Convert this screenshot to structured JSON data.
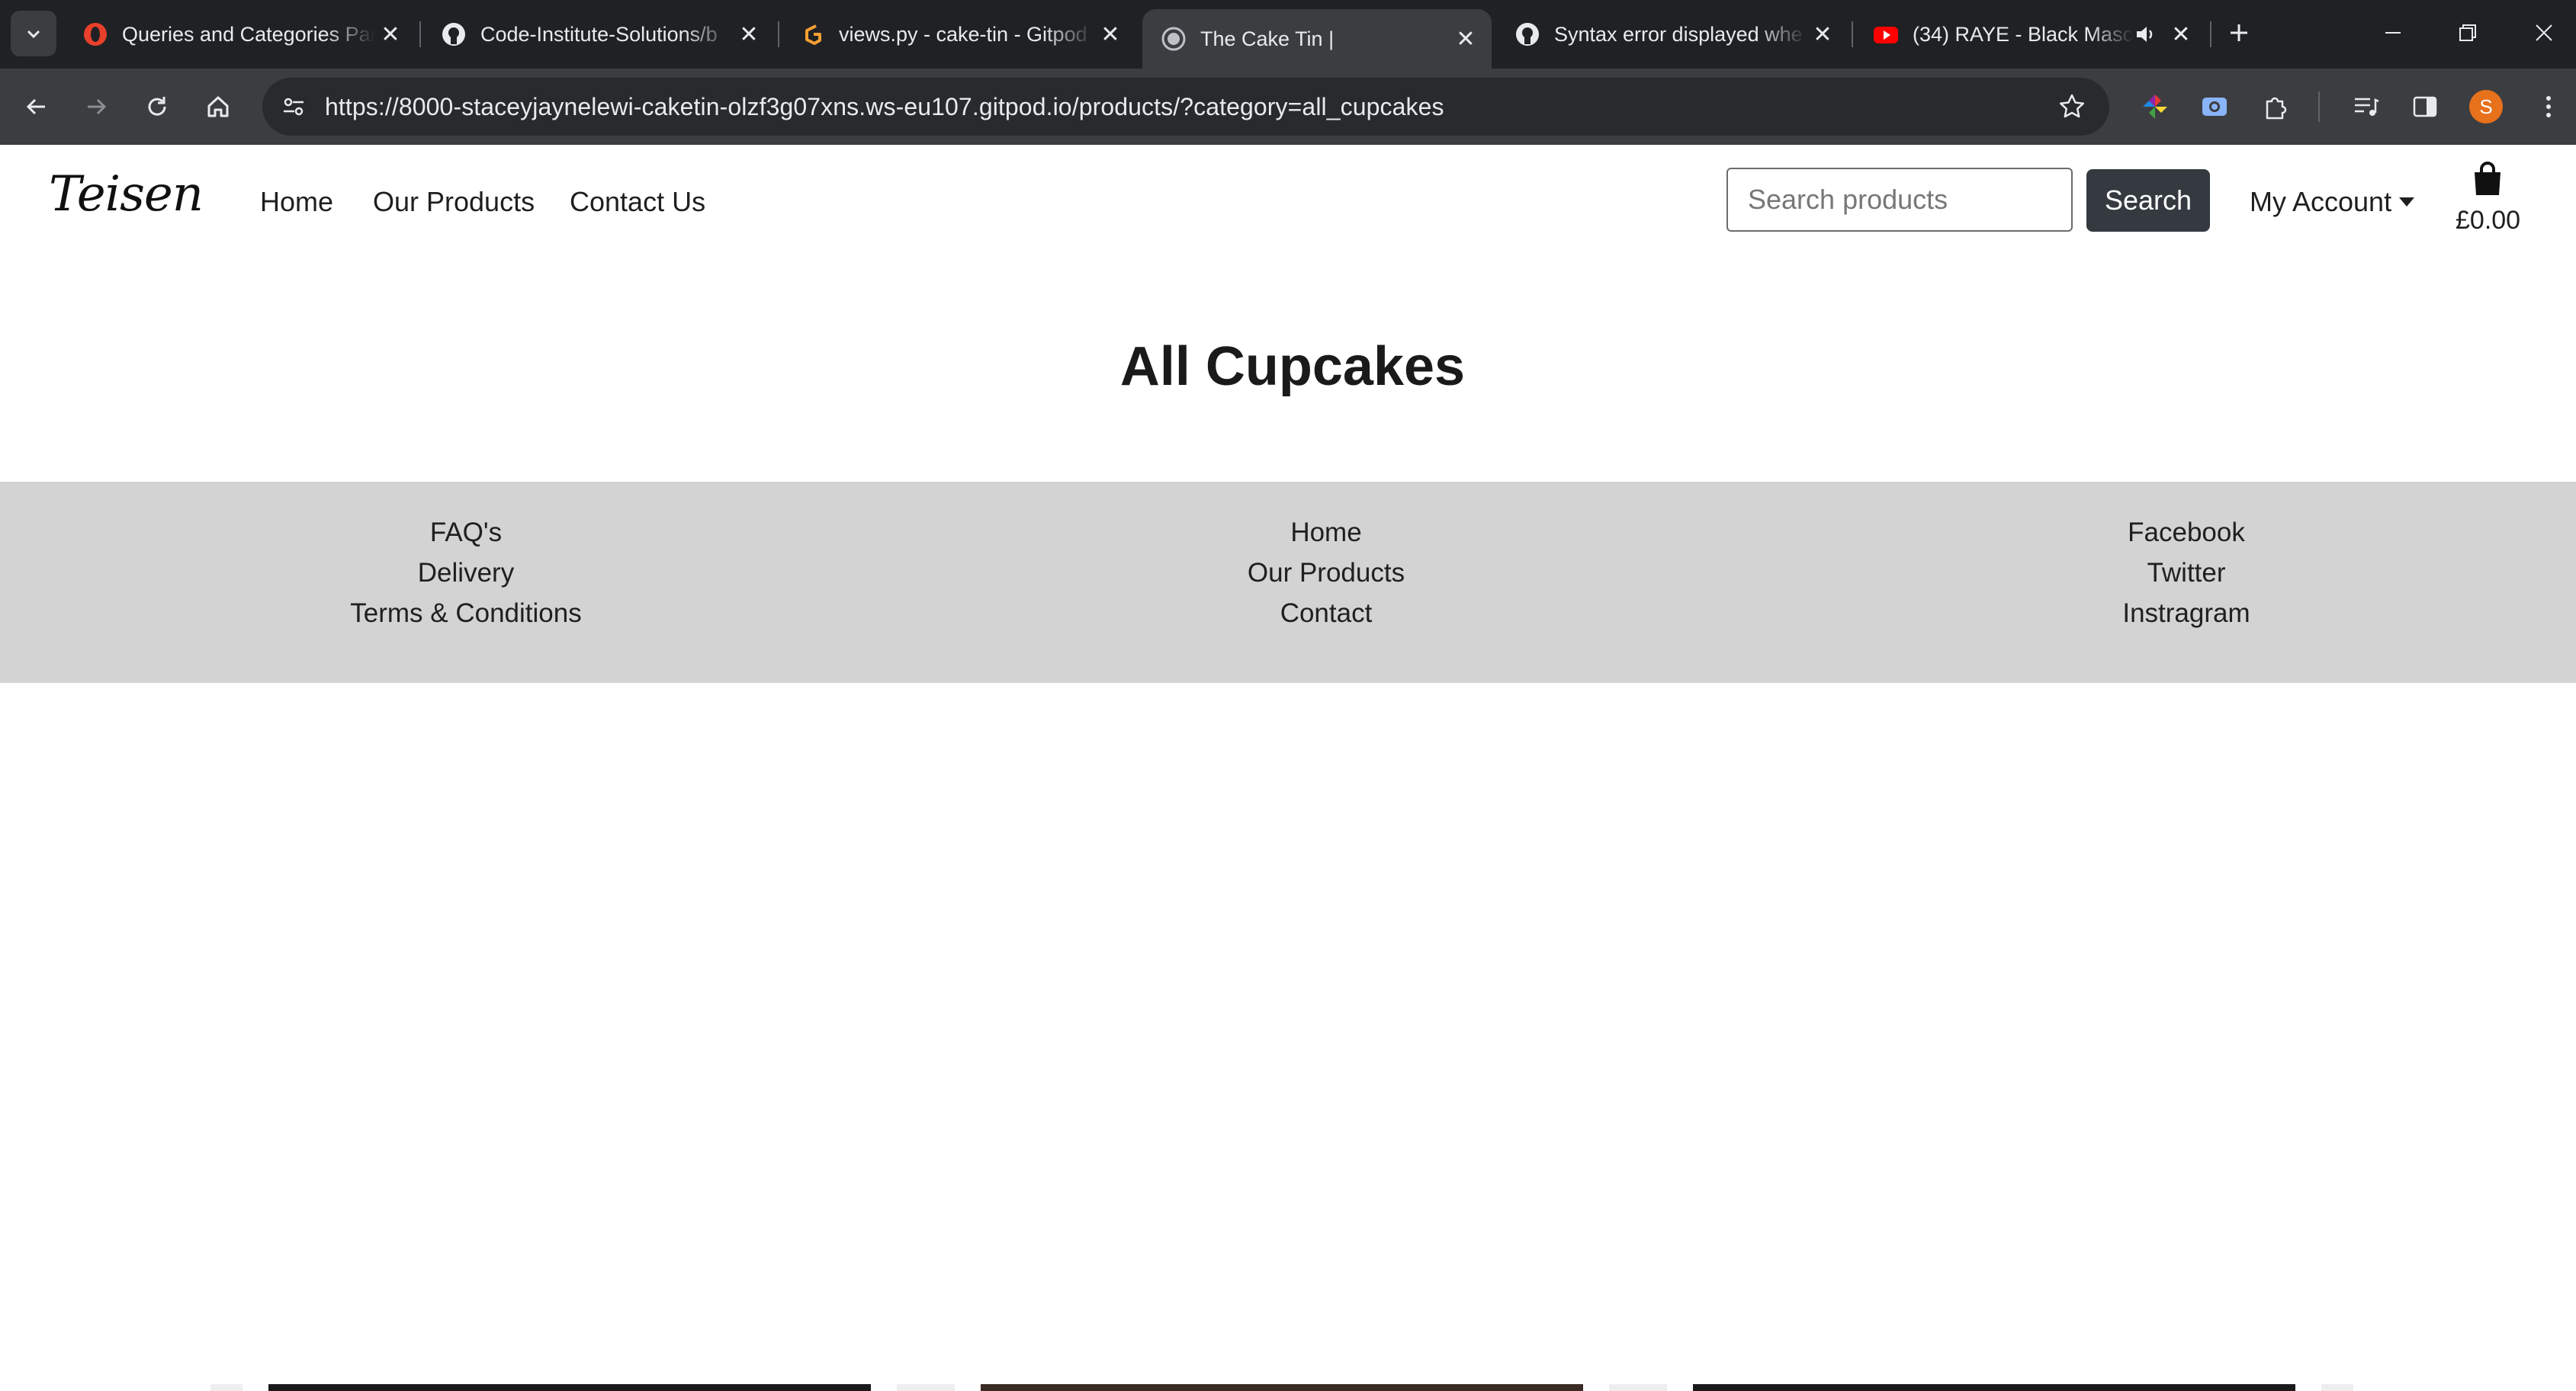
{
  "browser": {
    "tabs": [
      {
        "title": "Queries and Categories Par",
        "icon": "opera-red-icon",
        "active": false
      },
      {
        "title": "Code-Institute-Solutions/b",
        "icon": "github-icon",
        "active": false
      },
      {
        "title": "views.py - cake-tin - Gitpod",
        "icon": "gitpod-icon",
        "active": false
      },
      {
        "title": "The Cake Tin |",
        "icon": "globe-icon",
        "active": true
      },
      {
        "title": "Syntax error displayed whe",
        "icon": "github-icon",
        "active": false
      },
      {
        "title": "(34) RAYE - Black Masc",
        "icon": "youtube-icon",
        "active": false
      }
    ],
    "url": "https://8000-staceyjaynelewi-caketin-olzf3g07xns.ws-eu107.gitpod.io/products/?category=all_cupcakes",
    "profile_initial": "S"
  },
  "header": {
    "logo": "Teisen",
    "nav": {
      "home": "Home",
      "products": "Our Products",
      "contact": "Contact Us"
    },
    "search": {
      "placeholder": "Search products",
      "button": "Search"
    },
    "account": "My Account",
    "cart_total": "£0.00"
  },
  "main": {
    "title": "All Cupcakes"
  },
  "footer": {
    "col1": [
      "FAQ's",
      "Delivery",
      "Terms & Conditions"
    ],
    "col2": [
      "Home",
      "Our Products",
      "Contact"
    ],
    "col3": [
      "Facebook",
      "Twitter",
      "Instragram"
    ]
  },
  "colors": {
    "chrome_dark": "#202124",
    "toolbar": "#3c3d40",
    "button_dark": "#343a40",
    "footer_bg": "#d3d3d3"
  }
}
